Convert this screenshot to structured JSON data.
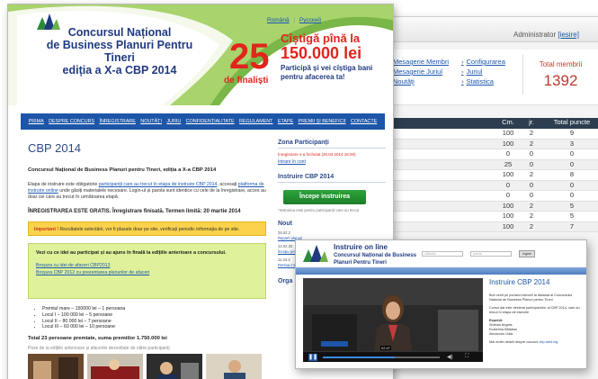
{
  "admin": {
    "user_label": "Administrator",
    "logout": "[iesire]",
    "links_col1": [
      "Mesagerie Membri",
      "Mesagerie Juriul",
      "Noutăți"
    ],
    "links_col2": [
      "Configurarea",
      "Juriul",
      "Statistica"
    ],
    "total_label": "Total membrii",
    "total_value": "1392",
    "table_headers": [
      "Cm.",
      "jr.",
      "Total puncte"
    ],
    "rows": [
      [
        "100",
        "2",
        "9"
      ],
      [
        "100",
        "2",
        "3"
      ],
      [
        "0",
        "0",
        "0"
      ],
      [
        "25",
        "0",
        "0"
      ],
      [
        "100",
        "2",
        "8"
      ],
      [
        "0",
        "0",
        "0"
      ],
      [
        "0",
        "0",
        "0"
      ],
      [
        "100",
        "2",
        "5"
      ],
      [
        "100",
        "2",
        "5"
      ],
      [
        "100",
        "2",
        "7"
      ]
    ]
  },
  "site": {
    "lang_ro": "Română",
    "lang_sep": "|",
    "lang_ru": "Русский",
    "title_lines": [
      "Concursul Național",
      "de Business Planuri Pentru Tineri",
      "ediția a X-a CBP 2014"
    ],
    "big_number": "25",
    "finalists": "de finaliști",
    "prize_line1": "Cîștigă pînă la",
    "prize_line2": "150.000 lei",
    "prize_line3": "Participă și vei cîștiga bani pentru afacerea ta!",
    "nav": [
      "PRIMA",
      "DESPRE CONCURS",
      "ÎNREGISTRARE",
      "NOUTĂȚI",
      "JURIU",
      "CONFIDENȚIALITATE",
      "REGULAMENT",
      "ETAPE",
      "PREMII ȘI BENEFICII",
      "CONTACTE"
    ],
    "heading": "CBP 2014",
    "subheading": "Concursul Național de Business Planuri pentru Tineri, ediția a X-a CBP 2014",
    "para_start": "Etapa de instruire este obligatorie ",
    "para_link1": "participanții care au trecut în etapa de instruire CBP 2014",
    "para_mid": ", accesați ",
    "para_link2": "platforma de instruire online",
    "para_end": " unde găsiți materialele necesare. Login-ul și parola sunt identice cu cele de la înregistrare, acces au doar cei care au trecut în următoarea etapă.",
    "registration": "ÎNREGISTRAREA ESTE GRATIS. Înregistrare finisată. Termen limită: 20 martie 2014",
    "important_label": "Important !",
    "important_text": " Rezultatele selectării, vor fi plasate doar pe site, verificați periodic informația de pe site.",
    "green_title": "Vezi cu ce idei au participat și au ajuns în finală la edițiile anterioare a concursului.",
    "green_link1": "Broșura cu idei de afaceri CBP2013",
    "green_link2": "Broșura CBP 2012 cu prezentarea planurilor de afaceri",
    "prizes": [
      "Premiul mare – 150000 lei – 1 persoana",
      "Locul I – 100 000 lei – 5 persoane",
      "Locul II – 80 000 lei – 7 persoane",
      "Locul III – 60 000 lei – 10 persoane"
    ],
    "total": "Total 23 persoane premiate, suma premiilor 1.750.000 lei",
    "photos_label": "Poze de la edițiile anterioare și afacerile dezvoltate de către participanți",
    "sidebar": {
      "zone_title": "Zona Participanți",
      "zone_note": "Înregistrare s-a încheiat (20.03.2014 16:00)",
      "login_link": "Intrare în cont",
      "training_title": "Instruire CBP 2014",
      "start_button": "Începe instruirea",
      "training_note": "*Instruirea este pentru participanții care au trecut",
      "news_title": "Nout",
      "news_items": [
        {
          "date": "26.02.2",
          "text": "Reparti planuri"
        },
        {
          "date": "12.02.20",
          "text": "Începu prezen"
        },
        {
          "date": "11.24.2",
          "text": "Persoa instruire"
        }
      ],
      "org_title": "Orga"
    }
  },
  "online": {
    "title_lines": [
      "Instruire on line",
      "Concursul Național de Business",
      "Planuri Pentru Tineri"
    ],
    "user_placeholder": "utilizator",
    "pass_placeholder": "parola",
    "login_button": "logare",
    "nav_home": "Acasă",
    "video_time": "02:47",
    "side_title": "Instruire CBP 2014",
    "side_p1": "Bun venit pe portalul instruirii la distanță al Concursului Național de Business Planuri pentru Tineri",
    "side_p2": "Cursul dat este destinat participanților al CBP 2014, care au trecut în etapa de instruire",
    "experts_label": "Experții:",
    "experts": [
      "Stoinan Angela",
      "Ecaterina Bălaban",
      "Alexandru Gaia"
    ],
    "more_text": "Mai multe detalii despre concurs ",
    "more_link": "cbp.aitnt.org"
  }
}
